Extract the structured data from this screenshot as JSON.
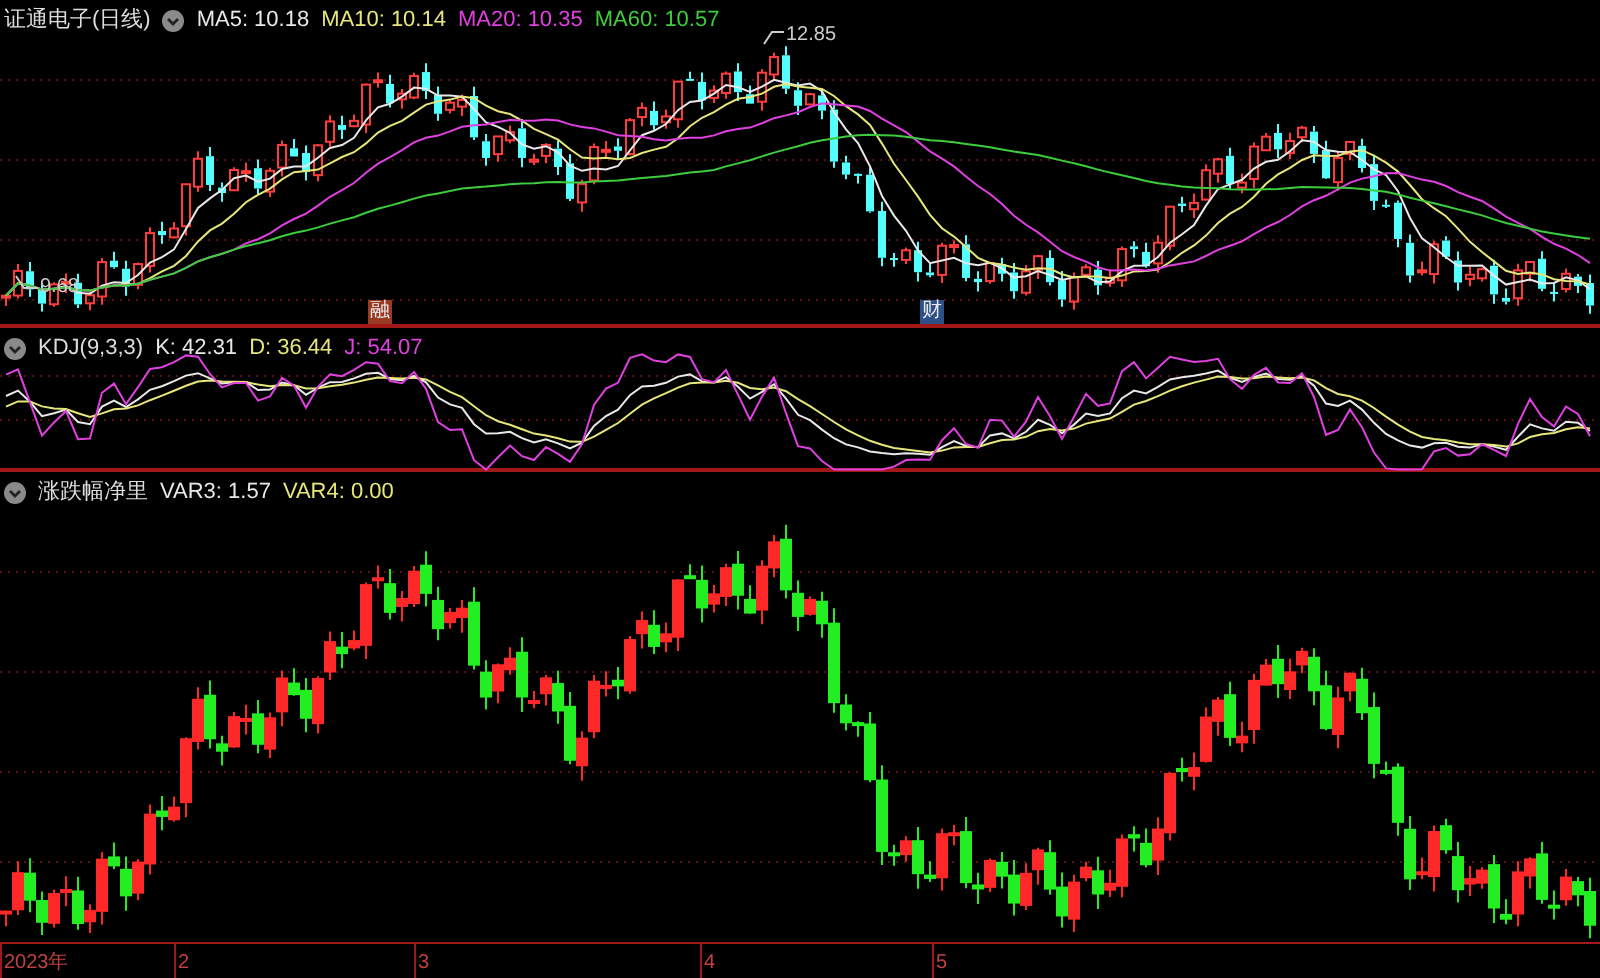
{
  "main_chart": {
    "title": "证通电子(日线)",
    "indicators": [
      {
        "label": "MA5: 10.18",
        "color": "#e8e8e8"
      },
      {
        "label": "MA10: 10.14",
        "color": "#e6e67a"
      },
      {
        "label": "MA20: 10.35",
        "color": "#e040e0"
      },
      {
        "label": "MA60: 10.57",
        "color": "#3ccc3c"
      }
    ],
    "high_label": "12.85",
    "low_label": "9.68",
    "event_badges": [
      {
        "text": "融",
        "color": "#9a3a22"
      },
      {
        "text": "财",
        "color": "#2c4f86"
      }
    ]
  },
  "kdj_panel": {
    "title": "KDJ(9,3,3)",
    "indicators": [
      {
        "label": "K: 42.31",
        "color": "#e8e8e8"
      },
      {
        "label": "D: 36.44",
        "color": "#e6e67a"
      },
      {
        "label": "J: 54.07",
        "color": "#e040e0"
      }
    ]
  },
  "net_panel": {
    "title": "涨跌幅净里",
    "indicators": [
      {
        "label": "VAR3: 1.57",
        "color": "#e8e8e8"
      },
      {
        "label": "VAR4: 0.00",
        "color": "#e6e67a"
      }
    ]
  },
  "x_axis": [
    "2023年",
    "2",
    "3",
    "4",
    "5"
  ]
}
